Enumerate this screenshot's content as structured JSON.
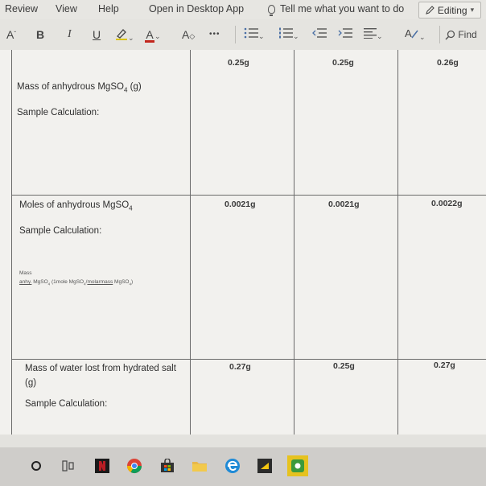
{
  "menu": {
    "review": "Review",
    "view": "View",
    "help": "Help",
    "open_desktop": "Open in Desktop App",
    "tell_me": "Tell me what you want to do",
    "editing": "Editing"
  },
  "toolbar": {
    "font_size_symbol": "A",
    "bold": "B",
    "italic": "I",
    "underline": "U",
    "font_color_letter": "A",
    "clear_format": "A",
    "more": "•••",
    "find": "Find"
  },
  "table": {
    "top_values": [
      "0.25g",
      "0.25g",
      "0.26g"
    ],
    "row1": {
      "label_pre": "Mass of anhydrous MgSO",
      "label_sub": "4",
      "label_post": " (g)",
      "sample": "Sample Calculation:"
    },
    "row2": {
      "label_pre": "Moles of anhydrous MgSO",
      "label_sub": "4",
      "sample": "Sample Calculation:",
      "values": [
        "0.0021g",
        "0.0021g",
        "0.0022g"
      ],
      "note_line1": "Mass",
      "note_anhy": "anhy.",
      "note_rest": " MgSO",
      "note_sub1": "4",
      "note_mid": " (1mole MgSO",
      "note_sub2": "4",
      "note_slash": "/",
      "note_molarmass": "molarmass",
      "note_end": " MgSO",
      "note_sub3": "4",
      "note_close": ")"
    },
    "row3": {
      "label_line1": "Mass of water lost from hydrated salt",
      "label_line2": "(g)",
      "sample": "Sample Calculation:",
      "values": [
        "0.27g",
        "0.25g",
        "0.27g"
      ]
    }
  },
  "colors": {
    "highlight": "#d9c200",
    "font_color": "#c2261d",
    "netflix": "#b81d24",
    "chrome_red": "#db4437",
    "edge": "#1f8ad6",
    "green_app": "#3c9a3c"
  }
}
